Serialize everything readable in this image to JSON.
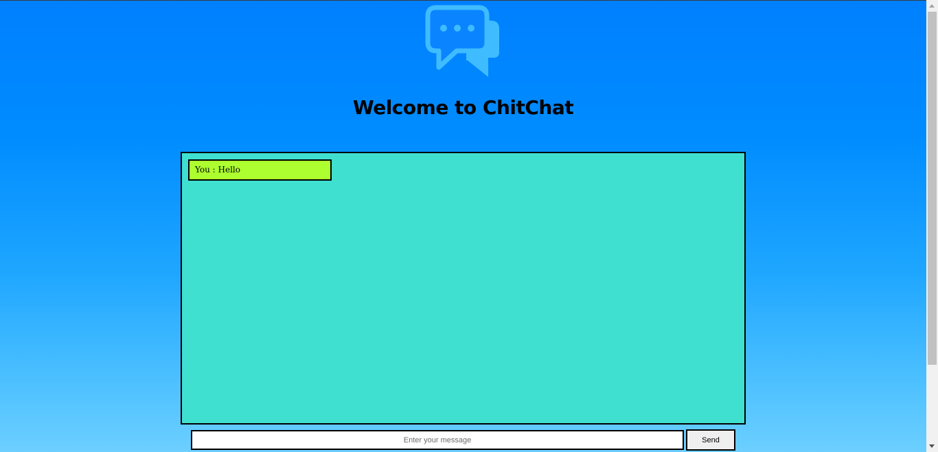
{
  "header": {
    "title": "Welcome to ChitChat"
  },
  "logo": {
    "icon": "chat-bubbles-icon",
    "color": "#3fbcff"
  },
  "chat": {
    "background": "#40e0d0",
    "messages": [
      {
        "text": "You : Hello",
        "background": "#adff2f"
      }
    ]
  },
  "composer": {
    "input_value": "",
    "input_placeholder": "Enter your message",
    "send_label": "Send"
  },
  "colors": {
    "page_gradient_top": "#0080ff",
    "page_gradient_bottom": "#6ccfff"
  },
  "scrollbar": {
    "up_icon": "scroll-up-arrow-icon",
    "down_icon": "scroll-down-arrow-icon"
  }
}
